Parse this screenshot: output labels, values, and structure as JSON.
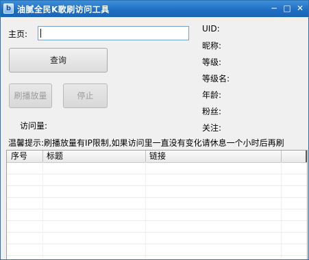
{
  "window": {
    "title": "油腻全民K歌刷访问工具",
    "icon": "app-icon",
    "icon_glyph": "b",
    "controls": {
      "minimize": "−",
      "maximize": "□",
      "close": "✕"
    },
    "titlebar_color": "#1f6fc5"
  },
  "form": {
    "homepage_label": "主页:",
    "homepage_value": "",
    "query_button": "查询",
    "boost_button": "刷播放量",
    "stop_button": "停止",
    "visits_label": "访问量:"
  },
  "info": {
    "uid_label": "UID:",
    "nickname_label": "昵称:",
    "level_label": "等级:",
    "level_name_label": "等级名:",
    "age_label": "年龄:",
    "fans_label": "粉丝:",
    "following_label": "关注:"
  },
  "tip": "温馨提示:刷播放量有IP限制,如果访问里一直没有变化请休息一个小时后再刷",
  "table": {
    "columns": [
      "序号",
      "标题",
      "链接"
    ],
    "rows": []
  }
}
